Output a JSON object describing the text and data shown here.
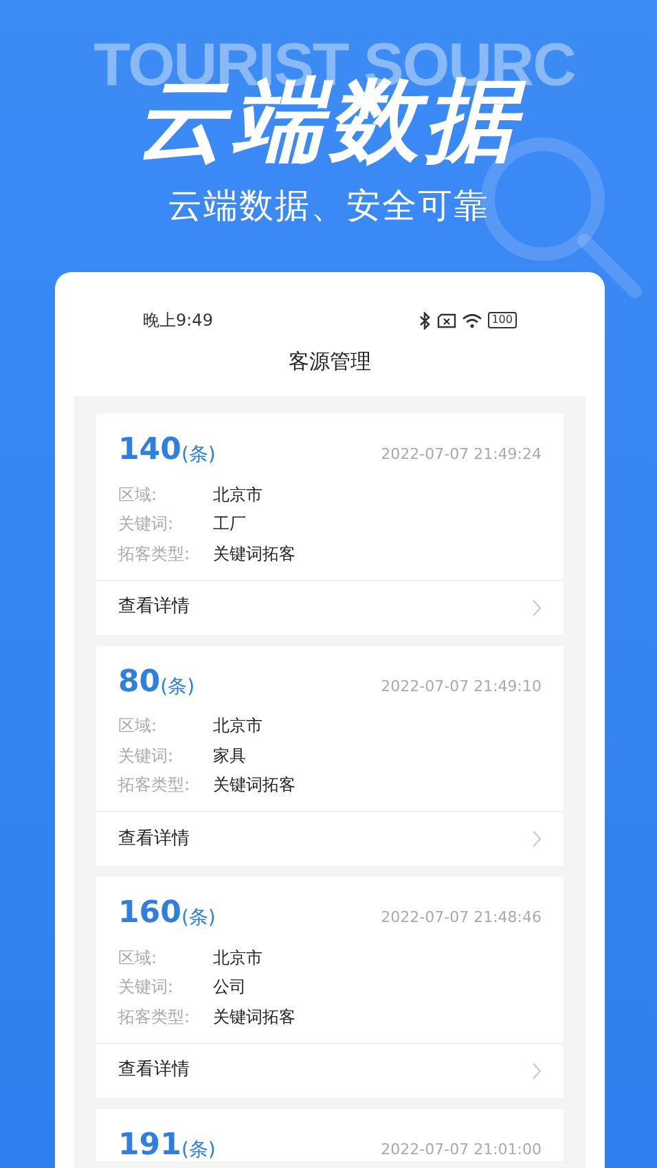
{
  "banner": {
    "watermark": "TOURIST SOURC",
    "headline": "云端数据",
    "subtitle": "云端数据、安全可靠"
  },
  "status_bar": {
    "time": "晚上9:49",
    "battery": "100"
  },
  "page_title": "客源管理",
  "records": [
    {
      "count": "140",
      "unit": "(条)",
      "time": "2022-07-07 21:49:24",
      "fields": [
        {
          "label": "区域:",
          "value": "北京市"
        },
        {
          "label": "关键词:",
          "value": "工厂"
        },
        {
          "label": "拓客类型:",
          "value": "关键词拓客"
        }
      ],
      "action": "查看详情"
    },
    {
      "count": "80",
      "unit": "(条)",
      "time": "2022-07-07 21:49:10",
      "fields": [
        {
          "label": "区域:",
          "value": "北京市"
        },
        {
          "label": "关键词:",
          "value": "家具"
        },
        {
          "label": "拓客类型:",
          "value": "关键词拓客"
        }
      ],
      "action": "查看详情"
    },
    {
      "count": "160",
      "unit": "(条)",
      "time": "2022-07-07 21:48:46",
      "fields": [
        {
          "label": "区域:",
          "value": "北京市"
        },
        {
          "label": "关键词:",
          "value": "公司"
        },
        {
          "label": "拓客类型:",
          "value": "关键词拓客"
        }
      ],
      "action": "查看详情"
    },
    {
      "count": "191",
      "unit": "(条)",
      "time": "2022-07-07 21:01:00"
    }
  ]
}
